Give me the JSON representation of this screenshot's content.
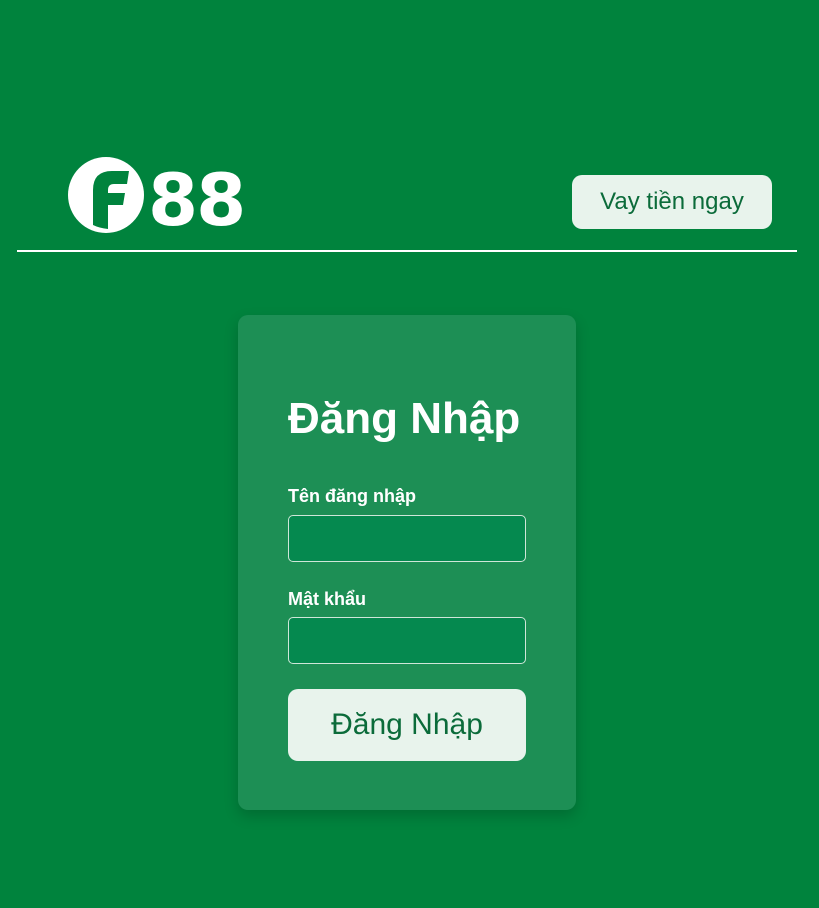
{
  "header": {
    "logo_text": "F88",
    "loan_button_label": "Vay tiền ngay"
  },
  "login": {
    "title": "Đăng Nhập",
    "username_label": "Tên đăng nhập",
    "username_value": "",
    "password_label": "Mật khẩu",
    "password_value": "",
    "submit_label": "Đăng Nhập"
  },
  "colors": {
    "background": "#00833d",
    "card": "#1d8f55",
    "input": "#05894f",
    "button_bg": "#e8f3ec",
    "button_text": "#0b6b3a"
  }
}
